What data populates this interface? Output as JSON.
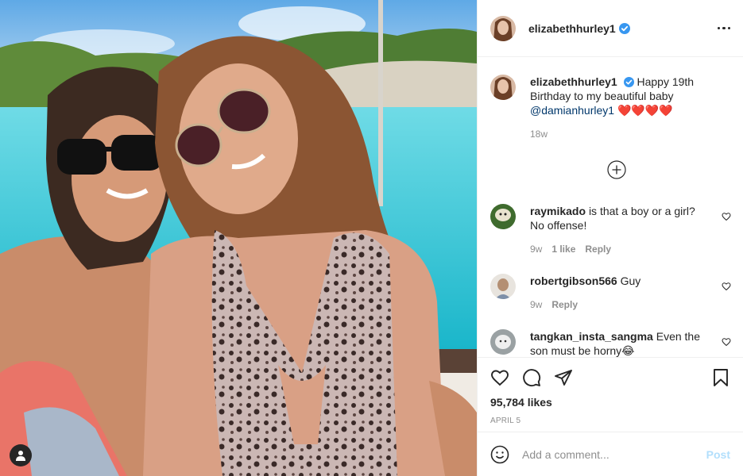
{
  "post": {
    "author": "elizabethhurley1",
    "verified": true,
    "caption_text": "Happy 19th Birthday to my beautiful baby",
    "caption_mention": "@damianhurley1",
    "caption_emoji": "❤️❤️❤️❤️",
    "caption_time": "18w",
    "likes": "95,784 likes",
    "date": "APRIL 5"
  },
  "comments": [
    {
      "user": "raymikado",
      "text": "is that a boy or a girl? No offense!",
      "time": "9w",
      "likes": "1 like",
      "reply": "Reply"
    },
    {
      "user": "robertgibson566",
      "text": "Guy",
      "time": "9w",
      "reply": "Reply"
    },
    {
      "user": "tangkan_insta_sangma",
      "text": "Even the son must be horny😂"
    }
  ],
  "add_comment": {
    "placeholder": "Add a comment...",
    "post_label": "Post"
  },
  "colors": {
    "verified_badge": "#3897f0",
    "mention": "#00376b",
    "post_button_disabled": "#b2dffc",
    "meta_text": "#8e8e8e"
  },
  "icons": [
    "user-tag-icon",
    "verified-badge-icon",
    "more-options-icon",
    "load-more-comments-icon",
    "comment-like-heart-icon",
    "like-heart-icon",
    "comment-bubble-icon",
    "share-paper-plane-icon",
    "save-bookmark-icon",
    "emoji-smiley-icon"
  ]
}
